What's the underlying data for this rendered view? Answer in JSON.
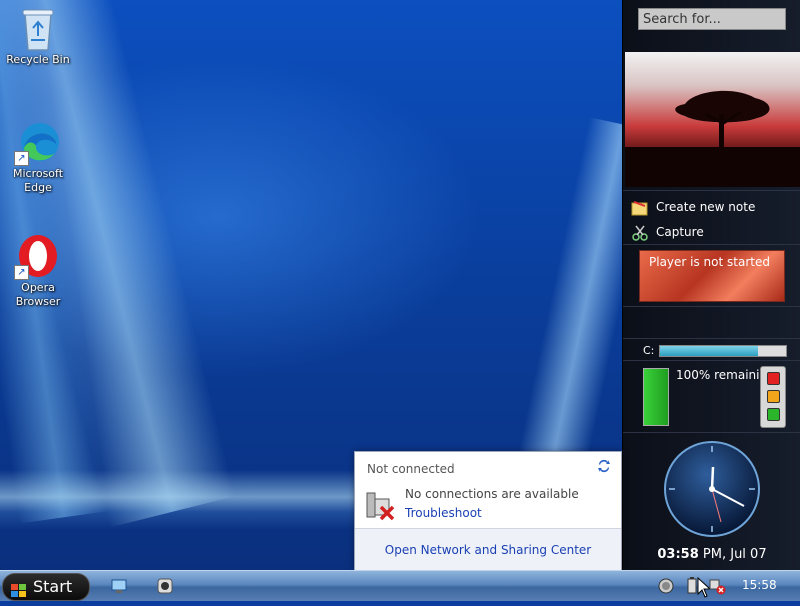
{
  "desktop": {
    "icons": [
      {
        "label_line1": "Recycle Bin",
        "label_line2": ""
      },
      {
        "label_line1": "Microsoft",
        "label_line2": "Edge"
      },
      {
        "label_line1": "Opera",
        "label_line2": "Browser"
      }
    ]
  },
  "sidebar": {
    "search_placeholder": "Search for...",
    "notes_label": "Create new note",
    "capture_label": "Capture",
    "player_status": "Player is not started",
    "disk_label": "C:",
    "disk_used_fraction": 0.78,
    "battery_text": "100% remaining",
    "battery_level": 1.0,
    "clock_time": "03:58",
    "clock_rest": " PM, Jul 07"
  },
  "network_popup": {
    "title": "Not connected",
    "message": "No connections are available",
    "troubleshoot_link": "Troubleshoot",
    "footer_link": "Open Network and Sharing Center"
  },
  "taskbar": {
    "start_label": "Start",
    "tray_time": "15:58"
  },
  "colors": {
    "accent_link": "#1a3fb3",
    "taskbar": "#3b669f",
    "desktop_blue": "#0a3e9c"
  }
}
